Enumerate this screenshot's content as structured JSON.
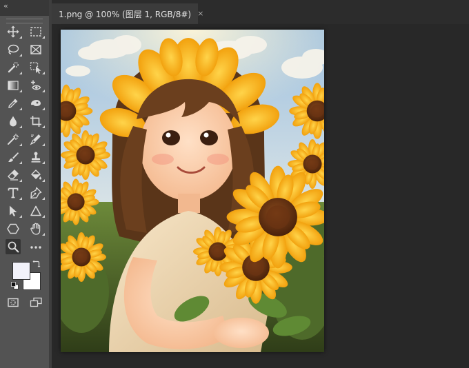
{
  "toolbar": {
    "collapse_glyph": "«",
    "tools": [
      {
        "name": "move-tool",
        "icon": "move-icon",
        "has_menu": true
      },
      {
        "name": "rectangular-marquee-tool",
        "icon": "rectangular-marquee-icon",
        "has_menu": true
      },
      {
        "name": "lasso-tool",
        "icon": "lasso-icon",
        "has_menu": true
      },
      {
        "name": "frame-tool",
        "icon": "frame-icon",
        "has_menu": false
      },
      {
        "name": "quick-selection-tool",
        "icon": "quick-selection-icon",
        "has_menu": true
      },
      {
        "name": "object-selection-tool",
        "icon": "object-selection-icon",
        "has_menu": true
      },
      {
        "name": "gradient-tool",
        "icon": "gradient-icon",
        "has_menu": true
      },
      {
        "name": "view-tool",
        "icon": "eye-plus-icon",
        "has_menu": true
      },
      {
        "name": "eyedropper-tool",
        "icon": "eyedropper-icon",
        "has_menu": true
      },
      {
        "name": "patch-tool",
        "icon": "patch-icon",
        "has_menu": true
      },
      {
        "name": "blur-tool",
        "icon": "blur-drop-icon",
        "has_menu": true
      },
      {
        "name": "crop-tool",
        "icon": "crop-icon",
        "has_menu": true
      },
      {
        "name": "magic-wand-tool",
        "icon": "magic-wand-icon",
        "has_menu": true
      },
      {
        "name": "color-replacement-tool",
        "icon": "color-replacement-icon",
        "has_menu": true
      },
      {
        "name": "brush-tool",
        "icon": "brush-icon",
        "has_menu": true
      },
      {
        "name": "clone-stamp-tool",
        "icon": "stamp-icon",
        "has_menu": true
      },
      {
        "name": "eraser-tool",
        "icon": "eraser-icon",
        "has_menu": true
      },
      {
        "name": "paint-bucket-tool",
        "icon": "paint-bucket-icon",
        "has_menu": true
      },
      {
        "name": "type-tool",
        "icon": "type-icon",
        "has_menu": true
      },
      {
        "name": "pen-tool",
        "icon": "pen-icon",
        "has_menu": true
      },
      {
        "name": "path-selection-tool",
        "icon": "arrow-cursor-icon",
        "has_menu": true
      },
      {
        "name": "triangle-tool",
        "icon": "triangle-icon",
        "has_menu": true
      },
      {
        "name": "polygon-tool",
        "icon": "hexagon-icon",
        "has_menu": false
      },
      {
        "name": "hand-tool",
        "icon": "hand-icon",
        "has_menu": true
      },
      {
        "name": "zoom-tool",
        "icon": "zoom-icon",
        "active": true,
        "has_menu": false
      },
      {
        "name": "more-tools",
        "icon": "more-icon",
        "has_menu": false
      }
    ],
    "foreground_color": "#f2f2fa",
    "background_color": "#ffffff",
    "quick_mask_icon": "quick-mask-icon",
    "screen_mode_icon": "screen-mode-icon"
  },
  "document": {
    "tab_title": "1.png @ 100% (图层 1, RGB/8#)",
    "close_glyph": "×"
  },
  "canvas": {
    "image": "illustration of a smiling girl with a sunflower crown holding sunflowers in a sunflower field under a blue sky"
  },
  "colors": {
    "toolbar_bg": "#535353",
    "app_bg": "#282828",
    "tab_active_bg": "#3b3b3b",
    "tab_bar_bg": "#2c2c2c",
    "icon": "#dadada",
    "tool_active_bg": "#353535"
  }
}
